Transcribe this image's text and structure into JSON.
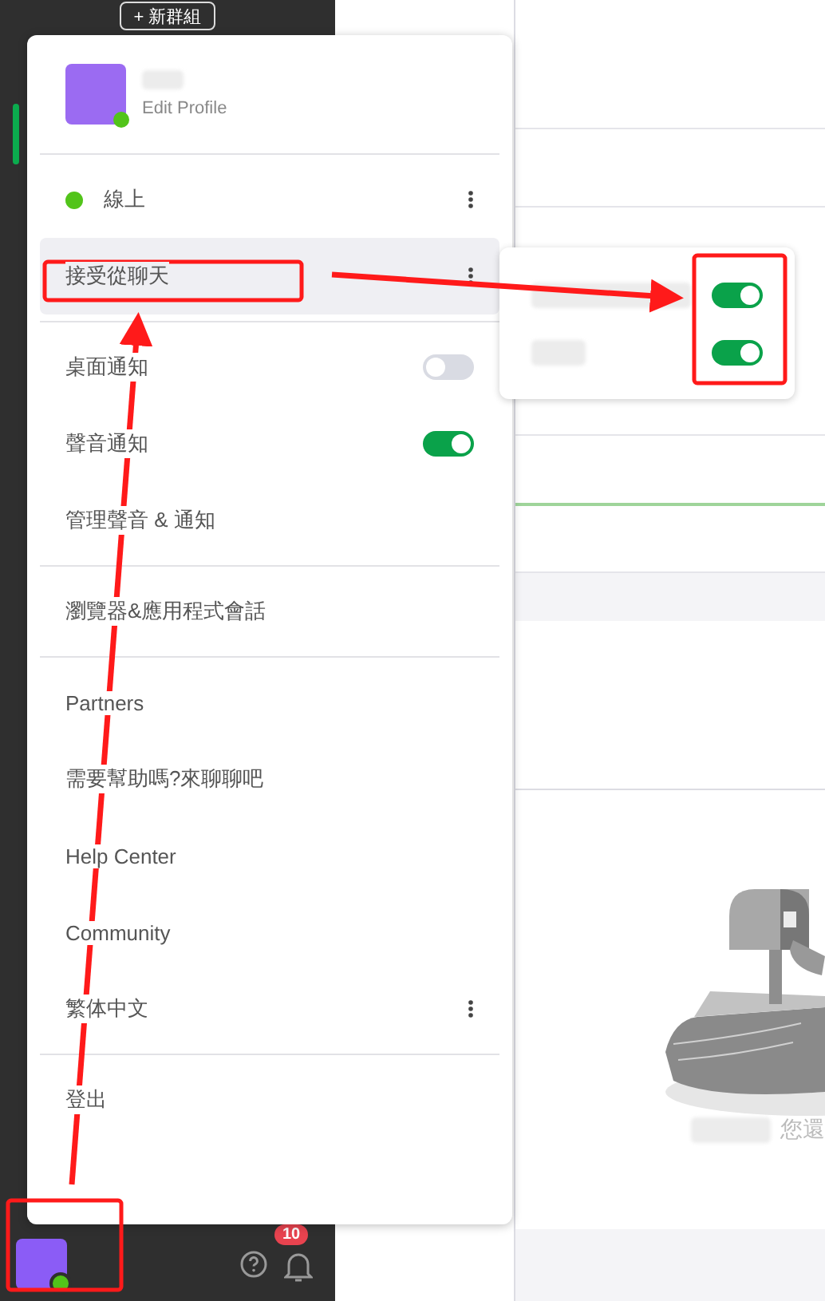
{
  "sidebar": {
    "new_group_button": "+ 新群組",
    "bottom_bar": {
      "online": true,
      "notification_badge": "10"
    }
  },
  "profile_menu": {
    "edit_profile": "Edit Profile",
    "online": true,
    "groups": [
      [
        {
          "kind": "status",
          "label": "線上",
          "highlighted": false,
          "more": true
        },
        {
          "kind": "plain",
          "label": "接受從聊天",
          "highlighted": true,
          "more": true
        }
      ],
      [
        {
          "kind": "toggle",
          "label": "桌面通知",
          "highlighted": false,
          "on": false
        },
        {
          "kind": "toggle",
          "label": "聲音通知",
          "highlighted": false,
          "on": true
        },
        {
          "kind": "plain",
          "label": "管理聲音 & 通知",
          "highlighted": false,
          "more": false
        }
      ],
      [
        {
          "kind": "plain",
          "label": "瀏覽器&應用程式會話",
          "highlighted": false,
          "more": false
        }
      ],
      [
        {
          "kind": "plain",
          "label": "Partners",
          "highlighted": false,
          "more": false
        },
        {
          "kind": "plain",
          "label": "需要幫助嗎?來聊聊吧",
          "highlighted": false,
          "more": false
        },
        {
          "kind": "plain",
          "label": "Help Center",
          "highlighted": false,
          "more": false
        },
        {
          "kind": "plain",
          "label": "Community",
          "highlighted": false,
          "more": false
        },
        {
          "kind": "plain",
          "label": "繁体中文",
          "highlighted": false,
          "more": true
        }
      ],
      [
        {
          "kind": "plain",
          "label": "登出",
          "highlighted": false,
          "more": false
        }
      ]
    ]
  },
  "submenu": {
    "toggles": [
      {
        "on": true
      },
      {
        "on": true
      }
    ]
  },
  "main": {
    "empty_state_text": "您還"
  }
}
